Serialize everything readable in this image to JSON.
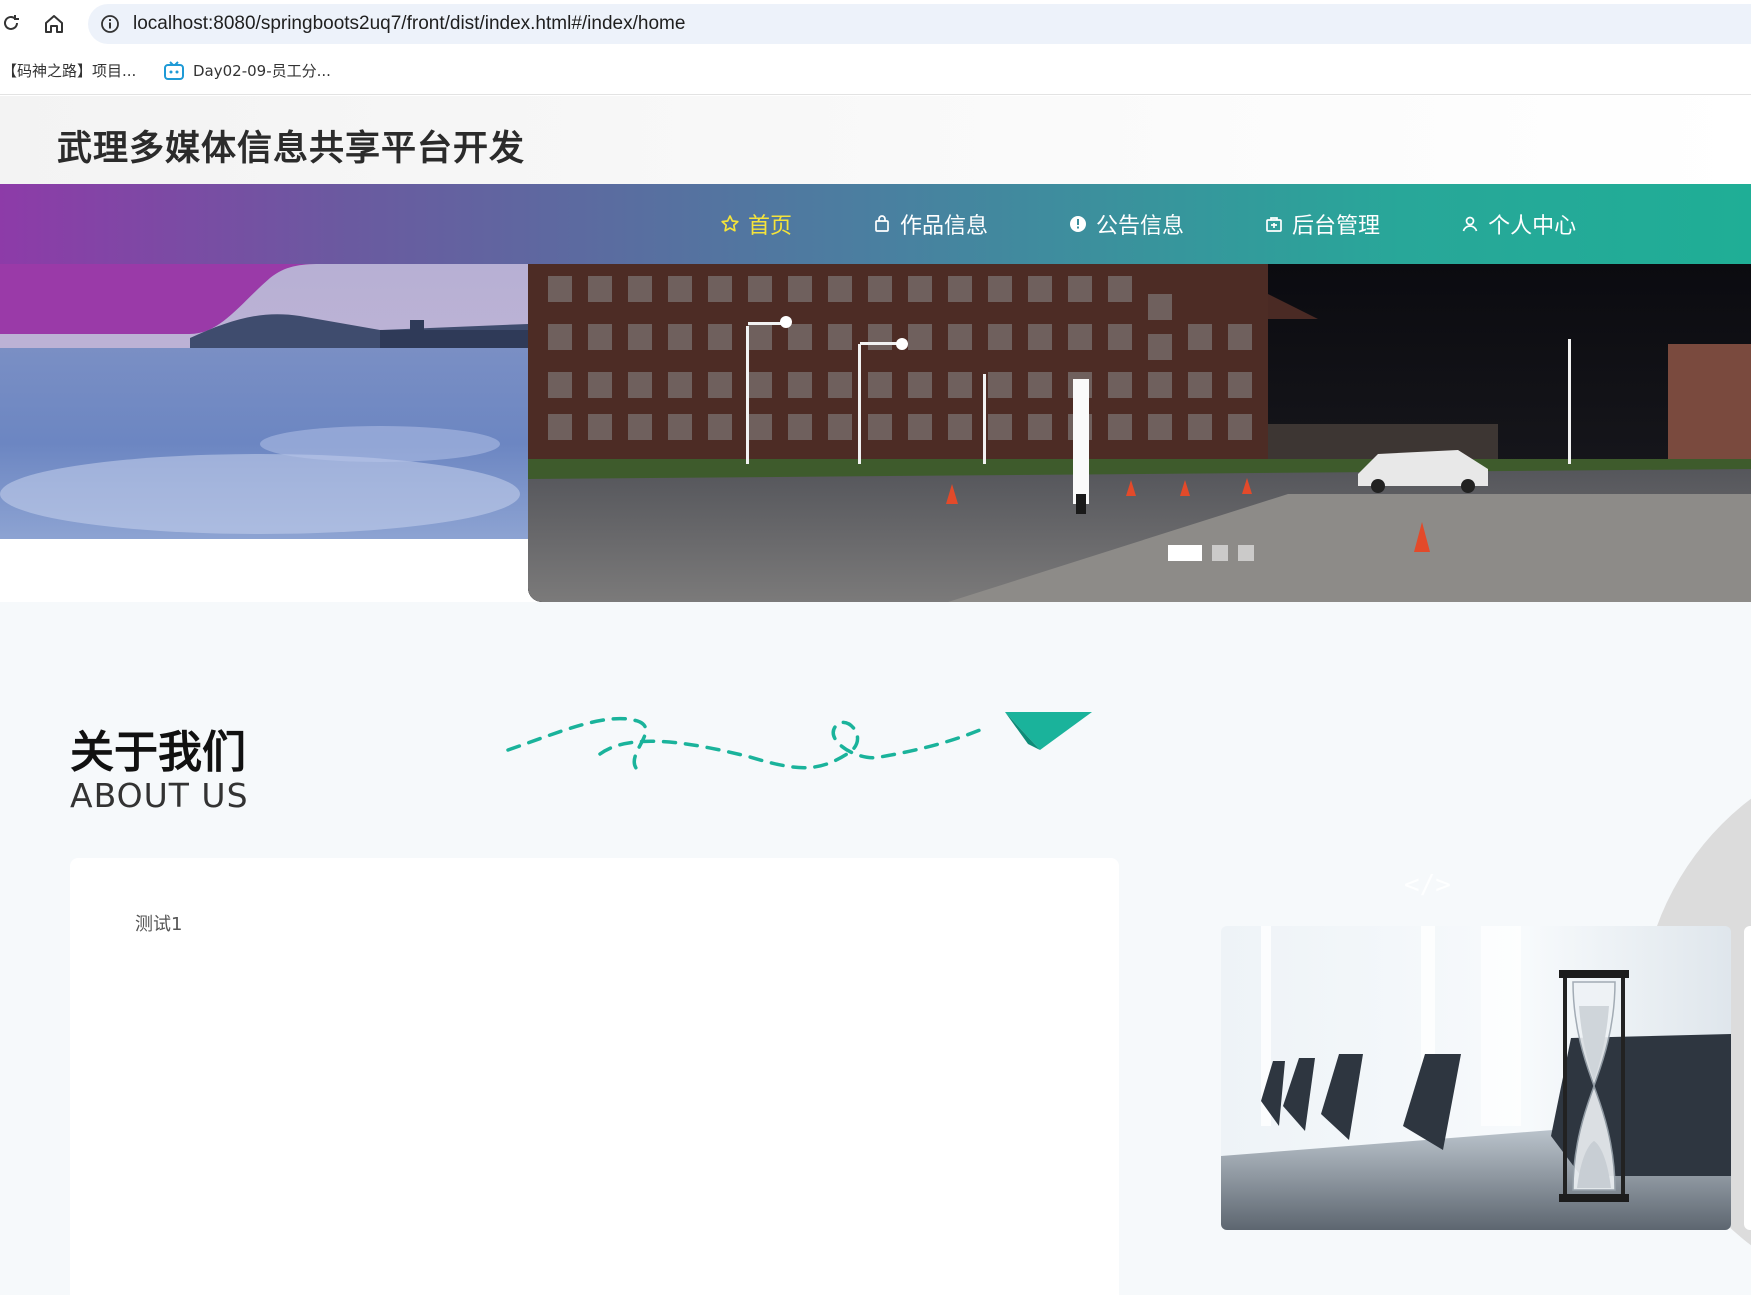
{
  "browser": {
    "url": "localhost:8080/springboots2uq7/front/dist/index.html#/index/home",
    "bookmarks": [
      {
        "label": "【码神之路】项目..."
      },
      {
        "label": "Day02-09-员工分..."
      }
    ]
  },
  "site": {
    "title": "武理多媒体信息共享平台开发"
  },
  "nav": {
    "items": [
      {
        "label": "首页",
        "icon": "star-icon",
        "active": true
      },
      {
        "label": "作品信息",
        "icon": "bag-icon",
        "active": false
      },
      {
        "label": "公告信息",
        "icon": "info-circle-icon",
        "active": false
      },
      {
        "label": "后台管理",
        "icon": "box-icon",
        "active": false
      },
      {
        "label": "个人中心",
        "icon": "user-icon",
        "active": false
      }
    ]
  },
  "carousel": {
    "slide_count": 3,
    "active_index": 0
  },
  "about": {
    "title": "关于我们",
    "subtitle": "ABOUT US",
    "content": "测试1"
  },
  "colors": {
    "nav_active": "#f5e43a",
    "nav_gradient_start": "#8d3ba8",
    "nav_gradient_end": "#1fae96",
    "accent_teal": "#1ab39b"
  }
}
